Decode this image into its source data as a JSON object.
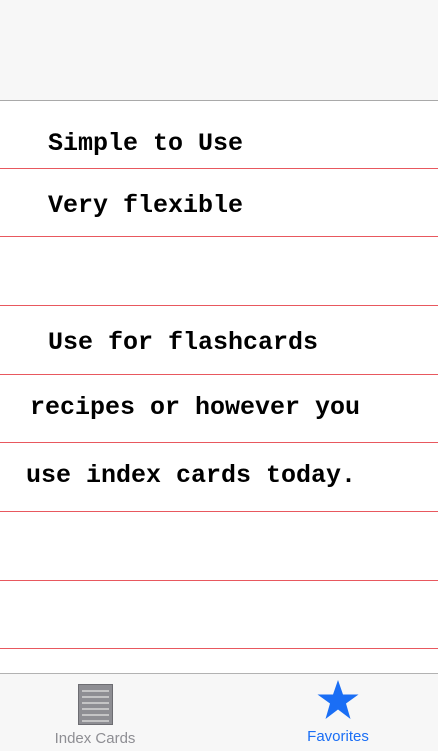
{
  "card": {
    "lines": [
      "Simple to Use",
      "Very flexible",
      "",
      "Use for flashcards",
      "recipes or however you",
      "use index cards today.",
      "",
      ""
    ]
  },
  "tabbar": {
    "tabs": [
      {
        "label": "Index Cards",
        "icon": "index-cards-icon",
        "selected": false
      },
      {
        "label": "Favorites",
        "icon": "star-icon",
        "selected": true
      }
    ]
  },
  "colors": {
    "rule": "#e8585e",
    "accent": "#1a6ef5",
    "inactive": "#8e8e93"
  }
}
